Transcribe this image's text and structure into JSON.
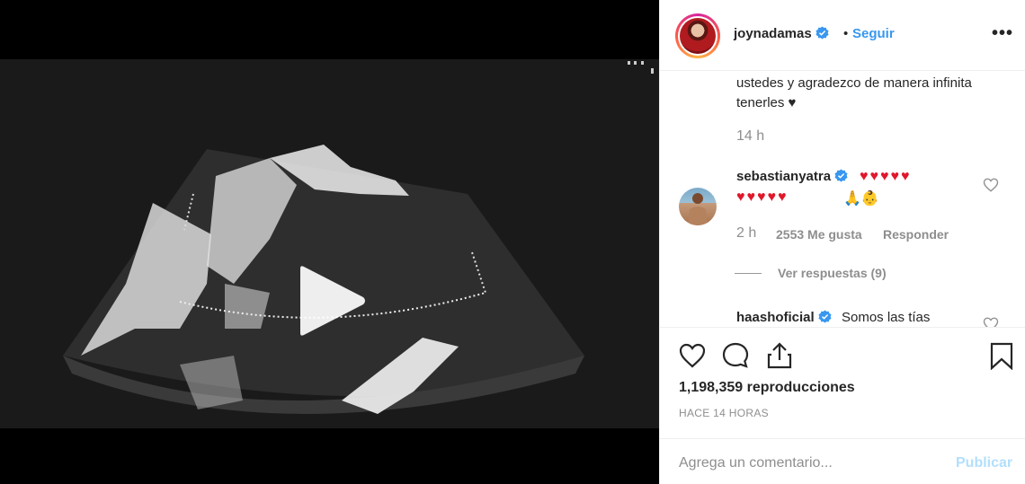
{
  "header": {
    "username": "joynadamas",
    "separator": "•",
    "follow_label": "Seguir",
    "more_label": "•••",
    "avatar_icon": "profile-avatar"
  },
  "caption": {
    "text": "ustedes y agradezco de manera infinita tenerles ♥",
    "time": "14 h"
  },
  "comments": [
    {
      "username": "sebastianyatra",
      "text_line1": "♥♥♥♥♥",
      "text_line2": "♥♥♥♥♥",
      "text_line2_extra": "🙏👶",
      "time": "2 h",
      "likes": "2553 Me gusta",
      "reply_label": "Responder",
      "view_replies": "Ver respuestas (9)"
    },
    {
      "username": "haashoficial",
      "text": "Somos las tías"
    }
  ],
  "actions": {
    "views": "1,198,359 reproducciones",
    "posted_ago": "HACE 14 HORAS"
  },
  "add_comment": {
    "placeholder": "Agrega un comentario...",
    "publish_label": "Publicar"
  },
  "colors": {
    "accent": "#3897f0",
    "publish_disabled": "#b2dffc",
    "secondary_text": "#8e8e8e"
  }
}
